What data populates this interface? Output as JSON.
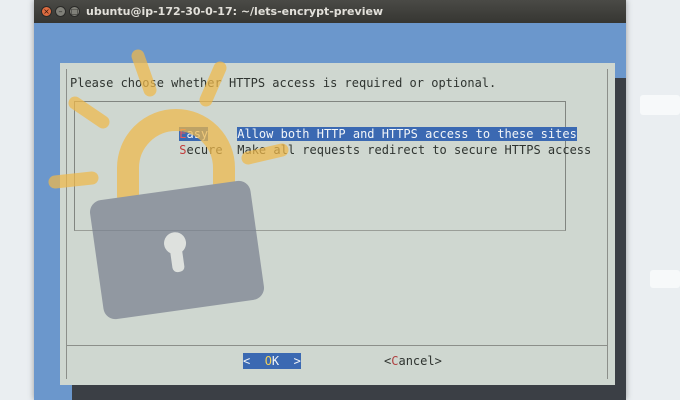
{
  "window": {
    "title": "ubuntu@ip-172-30-0-17: ~/lets-encrypt-preview",
    "controls": {
      "close": "×",
      "minimize": "–",
      "maximize": "□"
    }
  },
  "dialog": {
    "prompt": "Please choose whether HTTPS access is required or optional.",
    "options": [
      {
        "hotkey": "E",
        "tag_rest": "asy",
        "description": "Allow both HTTP and HTTPS access to these sites",
        "selected": true
      },
      {
        "hotkey": "S",
        "tag_rest": "ecure",
        "description": "Make all requests redirect to secure HTTPS access",
        "selected": false
      }
    ],
    "ok_button": {
      "left": "<  ",
      "hotkey": "O",
      "rest": "K",
      "right": "  >"
    },
    "cancel_button": {
      "left": "<",
      "hotkey": "C",
      "rest": "ancel",
      "right": ">"
    }
  },
  "colors": {
    "terminal_background": "#6b97cc",
    "dialog_background": "#cfd7d0",
    "selection": "#3b69b2",
    "hotkey": "#b04242",
    "lock_body": "#7a8190",
    "lock_rays": "#f0b94a"
  },
  "icons": {
    "background": "padlock-icon"
  }
}
